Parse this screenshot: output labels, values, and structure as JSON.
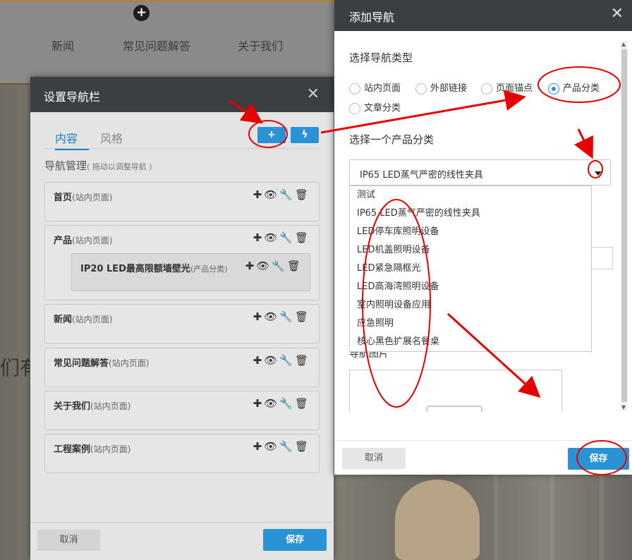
{
  "background_site": {
    "nav_items": [
      "新闻",
      "常见问题解答",
      "关于我们"
    ],
    "add_icon": "plus-circle-icon",
    "hero_text": "们有"
  },
  "nav_settings_dialog": {
    "title": "设置导航栏",
    "close_icon": "close-icon",
    "tabs": [
      "内容",
      "风格"
    ],
    "add_button_icon": "plus-icon",
    "quick_button_icon": "lightning-icon",
    "section_label": "导航管理",
    "section_hint": "( 拖动以调整导航 )",
    "entries": [
      {
        "name": "首页",
        "type": "(站内页面)"
      },
      {
        "name": "产品",
        "type": "(站内页面)",
        "child": {
          "name": "IP20 LED最高限额墙壁光",
          "type": "(产品分类)"
        }
      },
      {
        "name": "新闻",
        "type": "(站内页面)"
      },
      {
        "name": "常见问题解答",
        "type": "(站内页面)"
      },
      {
        "name": "关于我们",
        "type": "(站内页面)"
      },
      {
        "name": "工程案例",
        "type": "(站内页面)"
      }
    ],
    "tool_icons": [
      "plus-icon",
      "eye-icon",
      "wrench-icon",
      "trash-icon"
    ],
    "cancel_label": "取消",
    "save_label": "保存"
  },
  "add_nav_dialog": {
    "title": "添加导航",
    "close_icon": "close-icon",
    "type_heading": "选择导航类型",
    "types": [
      {
        "label": "站内页面",
        "checked": false
      },
      {
        "label": "外部链接",
        "checked": false
      },
      {
        "label": "页面锚点",
        "checked": false
      },
      {
        "label": "产品分类",
        "checked": true
      },
      {
        "label": "文章分类",
        "checked": false
      }
    ],
    "category_heading": "选择一个产品分类",
    "selected_category": "IP65 LED蒸气严密的线性夹具",
    "category_options": [
      "测试",
      "IP65 LED蒸气严密的线性夹具",
      "LED停车库照明设备",
      "LED机盖照明设备",
      "LED紧急隔框光",
      "LED高海湾照明设备",
      "室内照明设备应用",
      "应急照明",
      "核心黑色扩展名餐桌"
    ],
    "image_label": "导航图片",
    "cancel_label": "取消",
    "save_label": "保存"
  },
  "colors": {
    "accent_blue": "#2a93d5",
    "annotation_red": "#e60000",
    "titlebar_dark": "#3c3f42"
  }
}
